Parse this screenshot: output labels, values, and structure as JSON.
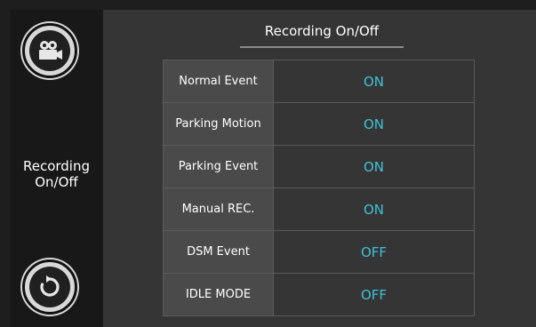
{
  "header": {
    "title": "Recording On/Off"
  },
  "sidebar": {
    "camera_icon": "video-camera-icon",
    "label_line1": "Recording",
    "label_line2": "On/Off",
    "back_icon": "rotate-back-icon"
  },
  "settings": [
    {
      "label": "Normal Event",
      "value": "ON"
    },
    {
      "label": "Parking Motion",
      "value": "ON"
    },
    {
      "label": "Parking Event",
      "value": "ON"
    },
    {
      "label": "Manual REC.",
      "value": "ON"
    },
    {
      "label": "DSM Event",
      "value": "OFF"
    },
    {
      "label": "IDLE MODE",
      "value": "OFF"
    }
  ],
  "colors": {
    "accent": "#3fc1d6",
    "panel": "#353535",
    "sidebar": "#181818"
  }
}
